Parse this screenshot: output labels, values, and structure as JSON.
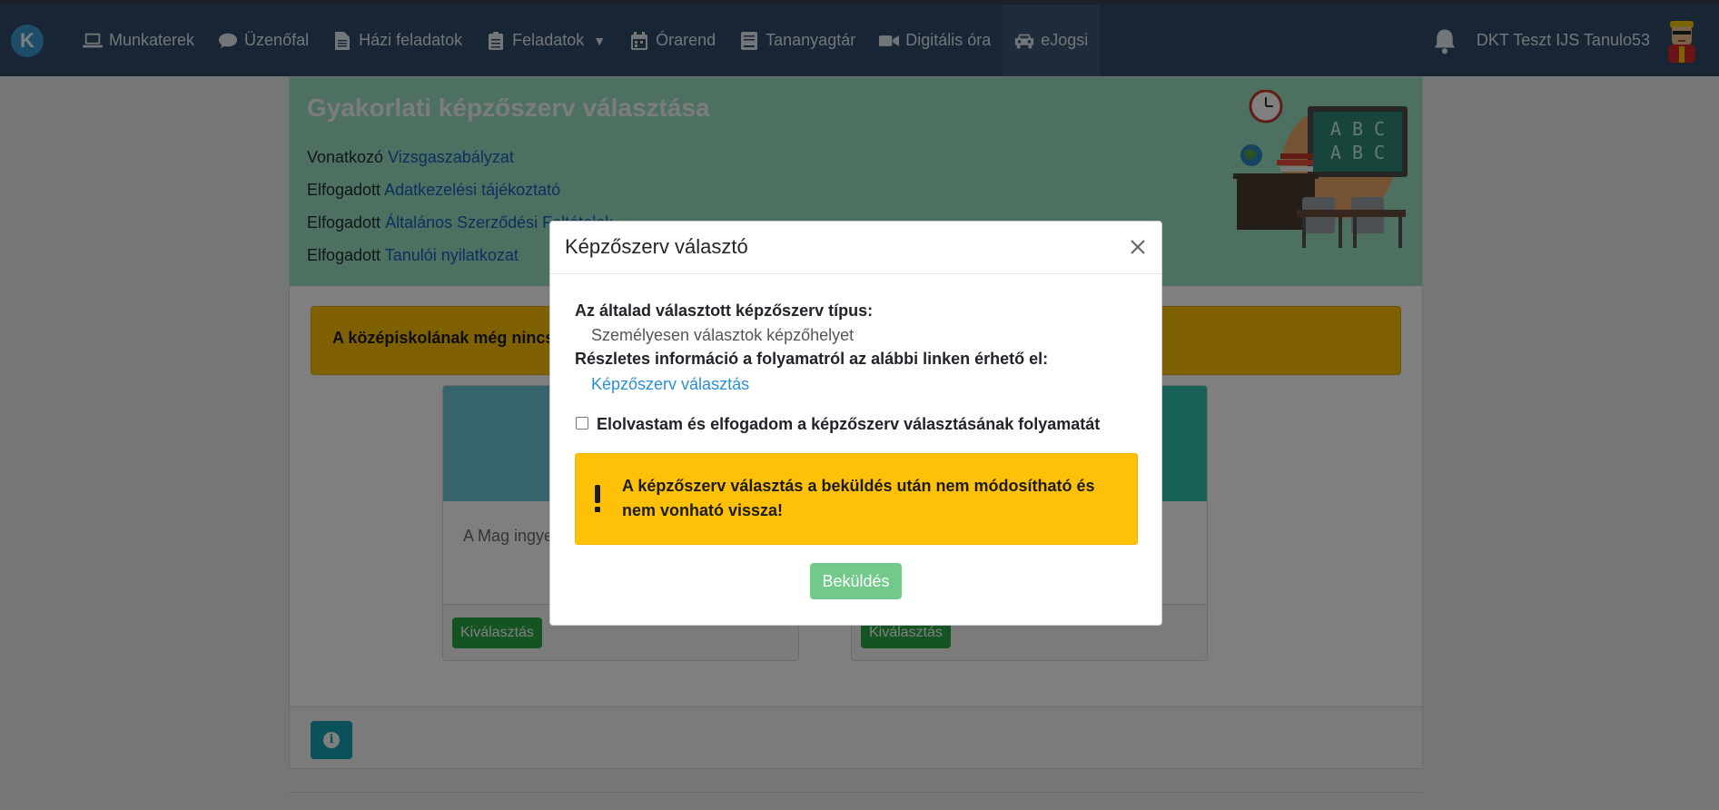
{
  "nav": {
    "logo": "K",
    "items": [
      {
        "label": "Munkaterek",
        "icon": "laptop-icon"
      },
      {
        "label": "Üzenőfal",
        "icon": "comment-icon"
      },
      {
        "label": "Házi feladatok",
        "icon": "file-icon"
      },
      {
        "label": "Feladatok",
        "icon": "clipboard-icon",
        "caret": "▼"
      },
      {
        "label": "Órarend",
        "icon": "calendar-icon"
      },
      {
        "label": "Tananyagtár",
        "icon": "book-icon"
      },
      {
        "label": "Digitális óra",
        "icon": "video-icon"
      },
      {
        "label": "eJogsi",
        "icon": "car-icon",
        "active": true
      }
    ],
    "username": "DKT Teszt IJS Tanulo53"
  },
  "hero": {
    "title": "Gyakorlati képzőszerv választása",
    "lines": [
      {
        "prefix": "Vonatkozó",
        "link": "Vizsgaszabályzat"
      },
      {
        "prefix": "Elfogadott",
        "link": "Adatkezelési tájékoztató"
      },
      {
        "prefix": "Elfogadott",
        "link": "Általános Szerződési Feltételek"
      },
      {
        "prefix": "Elfogadott",
        "link": "Tanulói nyilatkozat"
      }
    ]
  },
  "page_alert": "A középiskolának még nincs e",
  "cards": [
    {
      "text": "A Mag ingyene",
      "button": "Kiválasztás"
    },
    {
      "text": "",
      "button": "Kiválasztás"
    }
  ],
  "modal": {
    "title": "Képzőszerv választó",
    "type_label": "Az általad választott képzőszerv típus:",
    "type_value": "Személyesen választok képzőhelyet",
    "info_label": "Részletes információ a folyamatról az alábbi linken érhető el:",
    "info_link": "Képzőszerv választás",
    "checkbox_label": "Elolvastam és elfogadom a képzőszerv választásának folyamatát",
    "warning": "A képzőszerv választás a beküldés után nem módosítható és nem vonható vissza!",
    "submit": "Beküldés"
  },
  "colors": {
    "navbar": "#2f4a6b",
    "hero": "#9de0c3",
    "warning": "#ffc107",
    "success": "#28a745",
    "link": "#2b8fd4"
  }
}
